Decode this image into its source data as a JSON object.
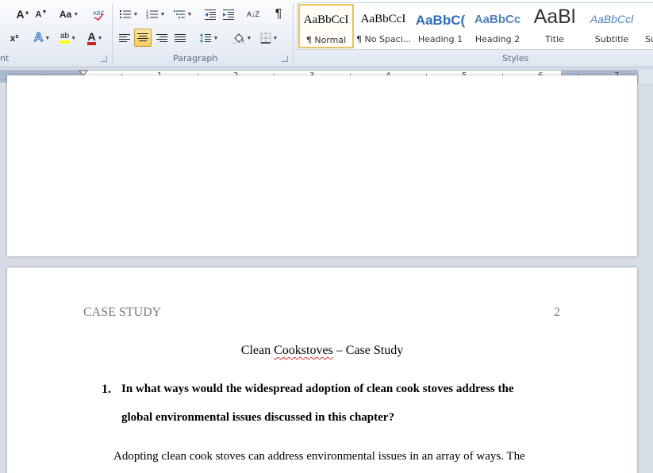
{
  "ribbon": {
    "font_group_label": "nt",
    "paragraph_group_label": "Paragraph",
    "styles_group_label": "Styles",
    "grow_font_glyph": "A",
    "shrink_font_glyph": "A",
    "change_case_label": "Aa",
    "superscript_label": "x²",
    "text_effects_glyph": "A",
    "highlight_label": "ab",
    "font_color_glyph": "A",
    "pilcrow": "¶",
    "sort_label": "A↓Z"
  },
  "styles": [
    {
      "sample": "AaBbCcI",
      "name": "¶ Normal",
      "selected": true
    },
    {
      "sample": "AaBbCcI",
      "name": "¶ No Spaci..."
    },
    {
      "sample": "AaBbC(",
      "name": "Heading 1"
    },
    {
      "sample": "AaBbCc",
      "name": "Heading 2"
    },
    {
      "sample": "AaBl",
      "name": "Title"
    },
    {
      "sample": "AaBbCcl",
      "name": "Subtitle"
    },
    {
      "sample": "",
      "name": "Su"
    }
  ],
  "ruler": {
    "numbers": [
      "1",
      "2",
      "3",
      "4",
      "5",
      "6",
      "7"
    ]
  },
  "document": {
    "running_head": "CASE STUDY",
    "page_number": "2",
    "title_part1": "Clean ",
    "title_misspelled": "Cookstoves",
    "title_part2": " – Case Study",
    "q_number": "1.",
    "q_line1": "In what ways would the widespread adoption of clean cook stoves address the",
    "q_line2": "global environmental issues discussed in this chapter?",
    "body_line1": "Adopting clean cook stoves can address environmental issues in an array of ways. The"
  },
  "colors": {
    "accent_blue": "#2e6db4",
    "font_color_red": "#d11f1f",
    "highlight_yellow": "#ffff00"
  }
}
